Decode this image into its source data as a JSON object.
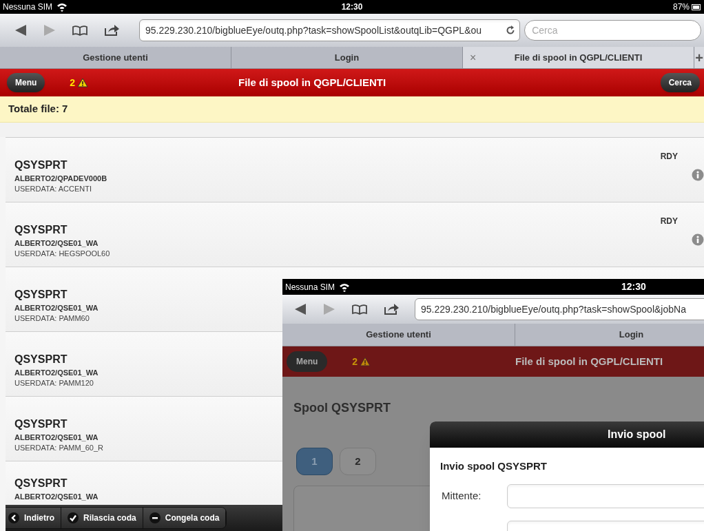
{
  "status_bar": {
    "carrier": "Nessuna SIM",
    "time": "12:30",
    "battery": "87%"
  },
  "browser": {
    "url": "95.229.230.210/bigblueEye/outq.php?task=showSpoolList&outqLib=QGPL&ou",
    "search_placeholder": "Cerca",
    "new_tab": "+",
    "tabs": [
      {
        "label": "Gestione utenti",
        "selected": false
      },
      {
        "label": "Login",
        "selected": false
      },
      {
        "label": "File di spool in QGPL/CLIENTI",
        "selected": true,
        "close": "×"
      }
    ]
  },
  "header": {
    "menu": "Menu",
    "alerts": "2",
    "title": "File di spool in QGPL/CLIENTI",
    "search": "Cerca"
  },
  "summary": "Totale file: 7",
  "spool_files": [
    {
      "name": "QSYSPRT",
      "job": "ALBERTO2/QPADEV000B",
      "userdata": "USERDATA: ACCENTI",
      "status": "RDY"
    },
    {
      "name": "QSYSPRT",
      "job": "ALBERTO2/QSE01_WA",
      "userdata": "USERDATA: HEGSPOOL60",
      "status": "RDY"
    },
    {
      "name": "QSYSPRT",
      "job": "ALBERTO2/QSE01_WA",
      "userdata": "USERDATA: PAMM60"
    },
    {
      "name": "QSYSPRT",
      "job": "ALBERTO2/QSE01_WA",
      "userdata": "USERDATA: PAMM120"
    },
    {
      "name": "QSYSPRT",
      "job": "ALBERTO2/QSE01_WA",
      "userdata": "USERDATA: PAMM_60_R"
    },
    {
      "name": "QSYSPRT",
      "job": "ALBERTO2/QSE01_WA"
    }
  ],
  "toolbar": [
    {
      "kind": "back",
      "label": "Indietro"
    },
    {
      "kind": "check",
      "label": "Rilascia coda"
    },
    {
      "kind": "minus",
      "label": "Congela coda"
    }
  ],
  "inset_screenshot": {
    "status_bar": {
      "carrier": "Nessuna SIM",
      "time": "12:30"
    },
    "url": "95.229.230.210/bigblueEye/outq.php?task=showSpool&jobNa",
    "tabs": [
      {
        "label": "Gestione utenti",
        "selected": false
      },
      {
        "label": "Login",
        "selected": false
      }
    ],
    "header": {
      "menu": "Menu",
      "alerts": "2",
      "title": "File di spool in QGPL/CLIENTI"
    },
    "page_title": "Spool QSYSPRT",
    "pages": [
      {
        "label": "1",
        "selected": true
      },
      {
        "label": "2",
        "selected": false
      }
    ],
    "dialog": {
      "title": "Invio spool",
      "heading": "Invio spool QSYSPRT",
      "fields": [
        {
          "kind": "labeled",
          "label": "Mittente:"
        },
        {
          "kind": "unlabeled"
        }
      ]
    }
  }
}
